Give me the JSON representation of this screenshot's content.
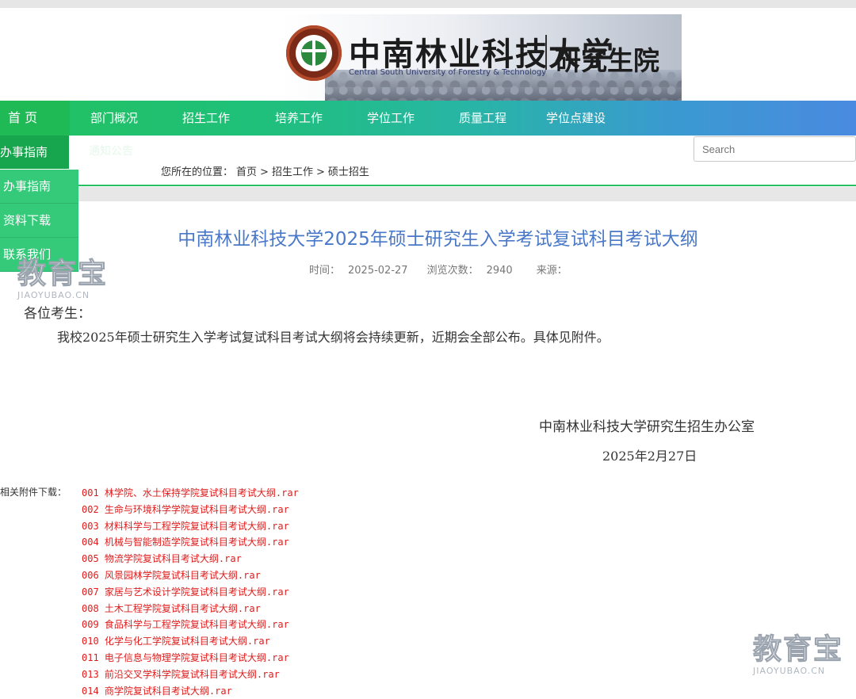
{
  "header": {
    "university_cn": "中南林业科技大学",
    "university_en": "Central South University of Forestry & Technology",
    "school": "研究生院"
  },
  "nav": {
    "items": [
      "首 页",
      "部门概况",
      "招生工作",
      "培养工作",
      "学位工作",
      "质量工程",
      "学位点建设"
    ]
  },
  "subnav": {
    "active": "办事指南",
    "ghost": "通知公告"
  },
  "search": {
    "placeholder": "Search"
  },
  "breadcrumb": {
    "prefix": "您所在的位置：",
    "items": [
      "首页",
      ">",
      "招生工作",
      ">",
      "硕士招生"
    ]
  },
  "sidebar": {
    "items": [
      "办事指南",
      "资料下载",
      "联系我们"
    ]
  },
  "watermark": {
    "big": "教育宝",
    "small": "JIAOYUBAO.CN"
  },
  "article": {
    "title": "中南林业科技大学2025年硕士研究生入学考试复试科目考试大纲",
    "meta": {
      "time_label": "时间：",
      "time": "2025-02-27",
      "views_label": "浏览次数：",
      "views": "2940",
      "source_label": "来源："
    },
    "greeting": "各位考生：",
    "body": "我校2025年硕士研究生入学考试复试科目考试大纲将会持续更新，近期会全部公布。具体见附件。",
    "signature_org": "中南林业科技大学研究生招生办公室",
    "signature_date": "2025年2月27日"
  },
  "attachments": {
    "label": "相关附件下载：",
    "files": [
      "001 林学院、水土保持学院复试科目考试大纲.rar",
      "002 生命与环境科学学院复试科目考试大纲.rar",
      "003 材料科学与工程学院复试科目考试大纲.rar",
      "004 机械与智能制造学院复试科目考试大纲.rar",
      "005 物流学院复试科目考试大纲.rar",
      "006 风景园林学院复试科目考试大纲.rar",
      "007 家居与艺术设计学院复试科目考试大纲.rar",
      "008 土木工程学院复试科目考试大纲.rar",
      "009 食品科学与工程学院复试科目考试大纲.rar",
      "010 化学与化工学院复试科目考试大纲.rar",
      "011 电子信息与物理学院复试科目考试大纲.rar",
      "013 前沿交叉学科学院复试科目考试大纲.rar",
      "014 商学院复试科目考试大纲.rar"
    ]
  }
}
